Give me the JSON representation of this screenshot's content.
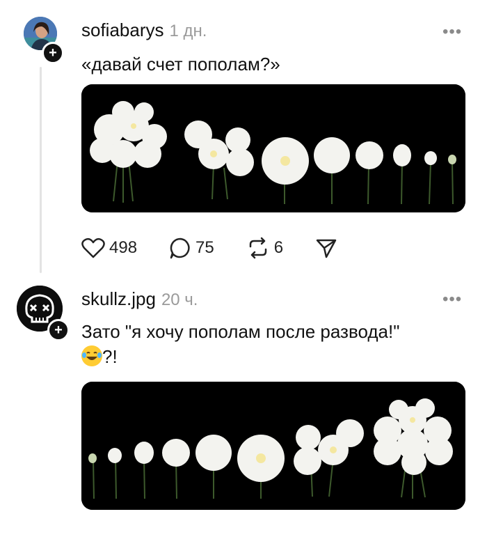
{
  "posts": [
    {
      "username": "sofiabarys",
      "time": "1 дн.",
      "more": "•••",
      "text": "«давай счет пополам?»",
      "likes": "498",
      "comments": "75",
      "reposts": "6",
      "follow": "+"
    },
    {
      "username": "skullz.jpg",
      "time": "20 ч.",
      "more": "•••",
      "text_line1": "Зато \"я хочу пополам после развода!\"",
      "text_line2": "?!",
      "follow": "+"
    }
  ],
  "icons": {
    "like": "heart-icon",
    "comment": "comment-bubble-icon",
    "repost": "repost-icon",
    "share": "send-icon",
    "emoji": "laughing-tears-emoji"
  },
  "colors": {
    "muted": "#9a9a9a",
    "text": "#111111",
    "media_bg": "#000000",
    "line": "#e3e3e3"
  }
}
